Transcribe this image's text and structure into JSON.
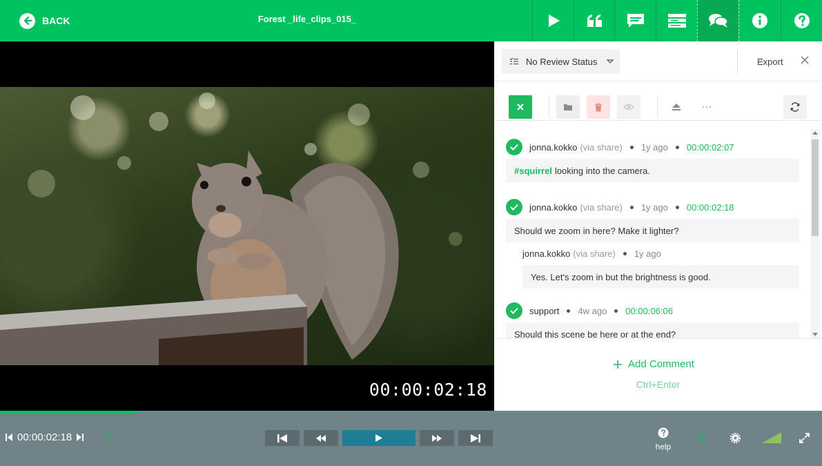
{
  "header": {
    "back_label": "BACK",
    "title": "Forest _life_clips_015_",
    "buttons": [
      "play-icon",
      "quote-icon",
      "comment-icon",
      "layout-icon",
      "chat-icon",
      "info-icon",
      "help-icon"
    ]
  },
  "video": {
    "timecode": "00:00:02:18"
  },
  "panel": {
    "review_status": "No Review Status",
    "export_label": "Export",
    "add_comment_label": "Add Comment",
    "add_comment_shortcut": "Ctrl+Enter",
    "comments": [
      {
        "author": "jonna.kokko",
        "via": "(via share)",
        "time": "1y ago",
        "timecode": "00:00:02:07",
        "tag": "#squirrel",
        "text": "looking into the camera."
      },
      {
        "author": "jonna.kokko",
        "via": "(via share)",
        "time": "1y ago",
        "timecode": "00:00:02:18",
        "text": "Should we zoom in here? Make it lighter?",
        "reply": {
          "author": "jonna.kokko",
          "via": "(via share)",
          "time": "1y ago",
          "text": "Yes. Let's zoom in but the brightness is good."
        }
      },
      {
        "author": "support",
        "time": "4w ago",
        "timecode": "00:00:06:06",
        "text": "Should this scene be here or at the end?"
      }
    ]
  },
  "player": {
    "timecode": "00:00:02:18",
    "progress_fraction": 0.166,
    "help_label": "help"
  },
  "colors": {
    "accent": "#00c35f",
    "controls_bg": "#6f8389"
  }
}
